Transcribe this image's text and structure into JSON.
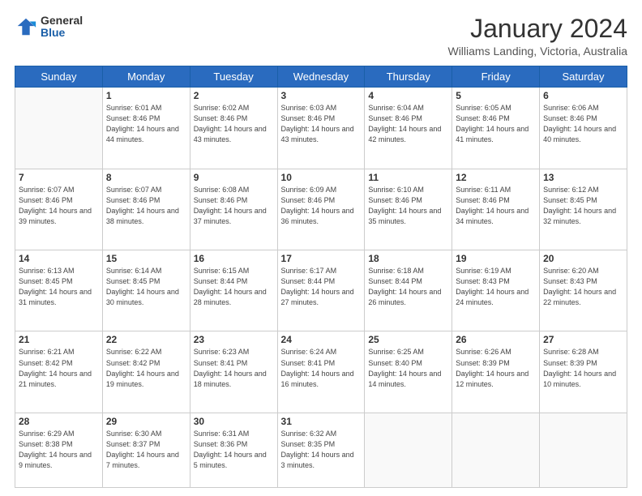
{
  "logo": {
    "general": "General",
    "blue": "Blue"
  },
  "header": {
    "title": "January 2024",
    "subtitle": "Williams Landing, Victoria, Australia"
  },
  "days_of_week": [
    "Sunday",
    "Monday",
    "Tuesday",
    "Wednesday",
    "Thursday",
    "Friday",
    "Saturday"
  ],
  "weeks": [
    [
      {
        "day": "",
        "sunrise": "",
        "sunset": "",
        "daylight": ""
      },
      {
        "day": "1",
        "sunrise": "Sunrise: 6:01 AM",
        "sunset": "Sunset: 8:46 PM",
        "daylight": "Daylight: 14 hours and 44 minutes."
      },
      {
        "day": "2",
        "sunrise": "Sunrise: 6:02 AM",
        "sunset": "Sunset: 8:46 PM",
        "daylight": "Daylight: 14 hours and 43 minutes."
      },
      {
        "day": "3",
        "sunrise": "Sunrise: 6:03 AM",
        "sunset": "Sunset: 8:46 PM",
        "daylight": "Daylight: 14 hours and 43 minutes."
      },
      {
        "day": "4",
        "sunrise": "Sunrise: 6:04 AM",
        "sunset": "Sunset: 8:46 PM",
        "daylight": "Daylight: 14 hours and 42 minutes."
      },
      {
        "day": "5",
        "sunrise": "Sunrise: 6:05 AM",
        "sunset": "Sunset: 8:46 PM",
        "daylight": "Daylight: 14 hours and 41 minutes."
      },
      {
        "day": "6",
        "sunrise": "Sunrise: 6:06 AM",
        "sunset": "Sunset: 8:46 PM",
        "daylight": "Daylight: 14 hours and 40 minutes."
      }
    ],
    [
      {
        "day": "7",
        "sunrise": "Sunrise: 6:07 AM",
        "sunset": "Sunset: 8:46 PM",
        "daylight": "Daylight: 14 hours and 39 minutes."
      },
      {
        "day": "8",
        "sunrise": "Sunrise: 6:07 AM",
        "sunset": "Sunset: 8:46 PM",
        "daylight": "Daylight: 14 hours and 38 minutes."
      },
      {
        "day": "9",
        "sunrise": "Sunrise: 6:08 AM",
        "sunset": "Sunset: 8:46 PM",
        "daylight": "Daylight: 14 hours and 37 minutes."
      },
      {
        "day": "10",
        "sunrise": "Sunrise: 6:09 AM",
        "sunset": "Sunset: 8:46 PM",
        "daylight": "Daylight: 14 hours and 36 minutes."
      },
      {
        "day": "11",
        "sunrise": "Sunrise: 6:10 AM",
        "sunset": "Sunset: 8:46 PM",
        "daylight": "Daylight: 14 hours and 35 minutes."
      },
      {
        "day": "12",
        "sunrise": "Sunrise: 6:11 AM",
        "sunset": "Sunset: 8:46 PM",
        "daylight": "Daylight: 14 hours and 34 minutes."
      },
      {
        "day": "13",
        "sunrise": "Sunrise: 6:12 AM",
        "sunset": "Sunset: 8:45 PM",
        "daylight": "Daylight: 14 hours and 32 minutes."
      }
    ],
    [
      {
        "day": "14",
        "sunrise": "Sunrise: 6:13 AM",
        "sunset": "Sunset: 8:45 PM",
        "daylight": "Daylight: 14 hours and 31 minutes."
      },
      {
        "day": "15",
        "sunrise": "Sunrise: 6:14 AM",
        "sunset": "Sunset: 8:45 PM",
        "daylight": "Daylight: 14 hours and 30 minutes."
      },
      {
        "day": "16",
        "sunrise": "Sunrise: 6:15 AM",
        "sunset": "Sunset: 8:44 PM",
        "daylight": "Daylight: 14 hours and 28 minutes."
      },
      {
        "day": "17",
        "sunrise": "Sunrise: 6:17 AM",
        "sunset": "Sunset: 8:44 PM",
        "daylight": "Daylight: 14 hours and 27 minutes."
      },
      {
        "day": "18",
        "sunrise": "Sunrise: 6:18 AM",
        "sunset": "Sunset: 8:44 PM",
        "daylight": "Daylight: 14 hours and 26 minutes."
      },
      {
        "day": "19",
        "sunrise": "Sunrise: 6:19 AM",
        "sunset": "Sunset: 8:43 PM",
        "daylight": "Daylight: 14 hours and 24 minutes."
      },
      {
        "day": "20",
        "sunrise": "Sunrise: 6:20 AM",
        "sunset": "Sunset: 8:43 PM",
        "daylight": "Daylight: 14 hours and 22 minutes."
      }
    ],
    [
      {
        "day": "21",
        "sunrise": "Sunrise: 6:21 AM",
        "sunset": "Sunset: 8:42 PM",
        "daylight": "Daylight: 14 hours and 21 minutes."
      },
      {
        "day": "22",
        "sunrise": "Sunrise: 6:22 AM",
        "sunset": "Sunset: 8:42 PM",
        "daylight": "Daylight: 14 hours and 19 minutes."
      },
      {
        "day": "23",
        "sunrise": "Sunrise: 6:23 AM",
        "sunset": "Sunset: 8:41 PM",
        "daylight": "Daylight: 14 hours and 18 minutes."
      },
      {
        "day": "24",
        "sunrise": "Sunrise: 6:24 AM",
        "sunset": "Sunset: 8:41 PM",
        "daylight": "Daylight: 14 hours and 16 minutes."
      },
      {
        "day": "25",
        "sunrise": "Sunrise: 6:25 AM",
        "sunset": "Sunset: 8:40 PM",
        "daylight": "Daylight: 14 hours and 14 minutes."
      },
      {
        "day": "26",
        "sunrise": "Sunrise: 6:26 AM",
        "sunset": "Sunset: 8:39 PM",
        "daylight": "Daylight: 14 hours and 12 minutes."
      },
      {
        "day": "27",
        "sunrise": "Sunrise: 6:28 AM",
        "sunset": "Sunset: 8:39 PM",
        "daylight": "Daylight: 14 hours and 10 minutes."
      }
    ],
    [
      {
        "day": "28",
        "sunrise": "Sunrise: 6:29 AM",
        "sunset": "Sunset: 8:38 PM",
        "daylight": "Daylight: 14 hours and 9 minutes."
      },
      {
        "day": "29",
        "sunrise": "Sunrise: 6:30 AM",
        "sunset": "Sunset: 8:37 PM",
        "daylight": "Daylight: 14 hours and 7 minutes."
      },
      {
        "day": "30",
        "sunrise": "Sunrise: 6:31 AM",
        "sunset": "Sunset: 8:36 PM",
        "daylight": "Daylight: 14 hours and 5 minutes."
      },
      {
        "day": "31",
        "sunrise": "Sunrise: 6:32 AM",
        "sunset": "Sunset: 8:35 PM",
        "daylight": "Daylight: 14 hours and 3 minutes."
      },
      {
        "day": "",
        "sunrise": "",
        "sunset": "",
        "daylight": ""
      },
      {
        "day": "",
        "sunrise": "",
        "sunset": "",
        "daylight": ""
      },
      {
        "day": "",
        "sunrise": "",
        "sunset": "",
        "daylight": ""
      }
    ]
  ]
}
